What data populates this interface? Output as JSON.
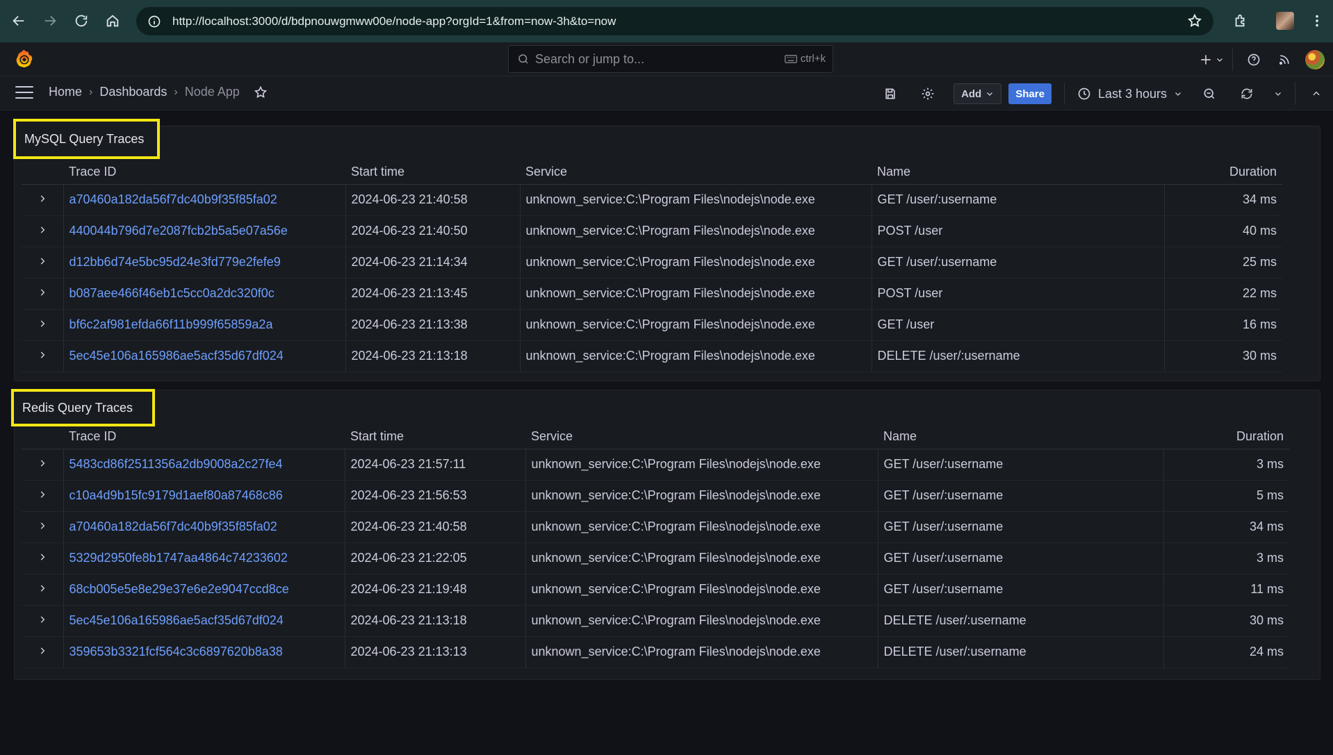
{
  "browser": {
    "url": "http://localhost:3000/d/bdpnouwgmww00e/node-app?orgId=1&from=now-3h&to=now"
  },
  "topbar": {
    "search_placeholder": "Search or jump to...",
    "shortcut": "ctrl+k"
  },
  "navbar": {
    "breadcrumb": [
      "Home",
      "Dashboards",
      "Node App"
    ],
    "add_label": "Add",
    "share_label": "Share",
    "time_range": "Last 3 hours"
  },
  "panels": [
    {
      "title": "MySQL Query Traces",
      "columns": [
        "Trace ID",
        "Start time",
        "Service",
        "Name",
        "Duration"
      ],
      "rows": [
        {
          "trace_id": "a70460a182da56f7dc40b9f35f85fa02",
          "start": "2024-06-23 21:40:58",
          "service": "unknown_service:C:\\Program Files\\nodejs\\node.exe",
          "name": "GET /user/:username",
          "duration": "34 ms"
        },
        {
          "trace_id": "440044b796d7e2087fcb2b5a5e07a56e",
          "start": "2024-06-23 21:40:50",
          "service": "unknown_service:C:\\Program Files\\nodejs\\node.exe",
          "name": "POST /user",
          "duration": "40 ms"
        },
        {
          "trace_id": "d12bb6d74e5bc95d24e3fd779e2fefe9",
          "start": "2024-06-23 21:14:34",
          "service": "unknown_service:C:\\Program Files\\nodejs\\node.exe",
          "name": "GET /user/:username",
          "duration": "25 ms"
        },
        {
          "trace_id": "b087aee466f46eb1c5cc0a2dc320f0c",
          "start": "2024-06-23 21:13:45",
          "service": "unknown_service:C:\\Program Files\\nodejs\\node.exe",
          "name": "POST /user",
          "duration": "22 ms"
        },
        {
          "trace_id": "bf6c2af981efda66f11b999f65859a2a",
          "start": "2024-06-23 21:13:38",
          "service": "unknown_service:C:\\Program Files\\nodejs\\node.exe",
          "name": "GET /user",
          "duration": "16 ms"
        },
        {
          "trace_id": "5ec45e106a165986ae5acf35d67df024",
          "start": "2024-06-23 21:13:18",
          "service": "unknown_service:C:\\Program Files\\nodejs\\node.exe",
          "name": "DELETE /user/:username",
          "duration": "30 ms"
        }
      ]
    },
    {
      "title": "Redis Query Traces",
      "columns": [
        "Trace ID",
        "Start time",
        "Service",
        "Name",
        "Duration"
      ],
      "rows": [
        {
          "trace_id": "5483cd86f2511356a2db9008a2c27fe4",
          "start": "2024-06-23 21:57:11",
          "service": "unknown_service:C:\\Program Files\\nodejs\\node.exe",
          "name": "GET /user/:username",
          "duration": "3 ms"
        },
        {
          "trace_id": "c10a4d9b15fc9179d1aef80a87468c86",
          "start": "2024-06-23 21:56:53",
          "service": "unknown_service:C:\\Program Files\\nodejs\\node.exe",
          "name": "GET /user/:username",
          "duration": "5 ms"
        },
        {
          "trace_id": "a70460a182da56f7dc40b9f35f85fa02",
          "start": "2024-06-23 21:40:58",
          "service": "unknown_service:C:\\Program Files\\nodejs\\node.exe",
          "name": "GET /user/:username",
          "duration": "34 ms"
        },
        {
          "trace_id": "5329d2950fe8b1747aa4864c74233602",
          "start": "2024-06-23 21:22:05",
          "service": "unknown_service:C:\\Program Files\\nodejs\\node.exe",
          "name": "GET /user/:username",
          "duration": "3 ms"
        },
        {
          "trace_id": "68cb005e5e8e29e37e6e2e9047ccd8ce",
          "start": "2024-06-23 21:19:48",
          "service": "unknown_service:C:\\Program Files\\nodejs\\node.exe",
          "name": "GET /user/:username",
          "duration": "11 ms"
        },
        {
          "trace_id": "5ec45e106a165986ae5acf35d67df024",
          "start": "2024-06-23 21:13:18",
          "service": "unknown_service:C:\\Program Files\\nodejs\\node.exe",
          "name": "DELETE /user/:username",
          "duration": "30 ms"
        },
        {
          "trace_id": "359653b3321fcf564c3c6897620b8a38",
          "start": "2024-06-23 21:13:13",
          "service": "unknown_service:C:\\Program Files\\nodejs\\node.exe",
          "name": "DELETE /user/:username",
          "duration": "24 ms"
        }
      ]
    }
  ]
}
